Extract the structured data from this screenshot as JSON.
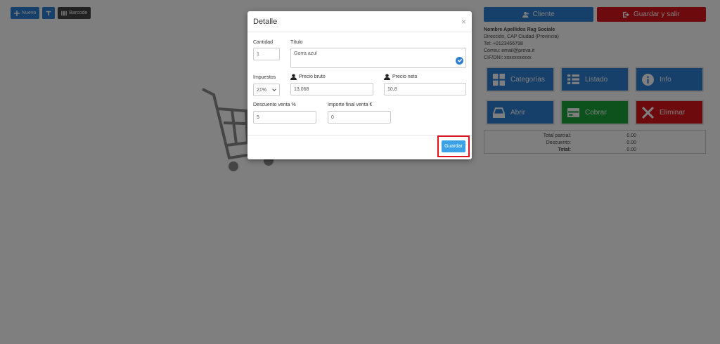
{
  "toolbar": {
    "new_label": "Nuevo",
    "barcode_label": "Barcode"
  },
  "header": {
    "client_label": "Cliente",
    "save_exit_label": "Guardar y salir"
  },
  "customer": {
    "name": "Nombre Apellidos Rag Sociale",
    "address": "Dirección, CAP Ciudad (Provincia)",
    "phone": "Tel: +0123456798",
    "email": "Correu: email@prova.it",
    "taxid": "CIF/DNI: xxxxxxxxxxx"
  },
  "actions": [
    {
      "label": "Categorías",
      "icon": "grid-icon",
      "color": "#2c7fd3"
    },
    {
      "label": "Listado",
      "icon": "list-icon",
      "color": "#2c7fd3"
    },
    {
      "label": "Info",
      "icon": "info-icon",
      "color": "#2c7fd3"
    },
    {
      "label": "Abrir",
      "icon": "drawer-icon",
      "color": "#2c7fd3"
    },
    {
      "label": "Cobrar",
      "icon": "card-icon",
      "color": "#1aa33b"
    },
    {
      "label": "Eliminar",
      "icon": "close-icon",
      "color": "#d9141b"
    }
  ],
  "totals": {
    "subtotal_label": "Total parcial:",
    "subtotal_value": "0.00",
    "discount_label": "Descuento:",
    "discount_value": "0.00",
    "total_label": "Total:",
    "total_value": "0.00"
  },
  "modal": {
    "title": "Detalle",
    "close": "×",
    "quantity_label": "Cantidad",
    "quantity_value": "1",
    "title_label": "Título",
    "title_value": "Gorra azul",
    "tax_label": "Impuestos",
    "tax_value": "21%",
    "gross_price_label": "Precio bruto",
    "gross_price_value": "13,068",
    "net_price_label": "Precio neto",
    "net_price_value": "10,8",
    "discount_label": "Descuento venta %",
    "discount_value": "5",
    "final_amount_label": "Importe final venta €",
    "final_amount_value": "0",
    "save_label": "Guardar"
  },
  "colors": {
    "primary": "#2c7fd3",
    "danger": "#d9141b",
    "success": "#1aa33b",
    "highlight": "#e0121b"
  }
}
